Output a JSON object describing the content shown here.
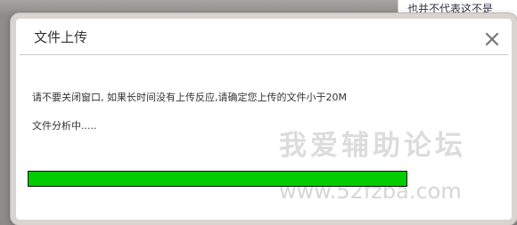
{
  "background": {
    "partial_text": "也并不代表这不是"
  },
  "dialog": {
    "title": "文件上传",
    "close_icon": "close-x-icon",
    "message": "请不要关闭窗口, 如果长时间没有上传反应,请确定您上传的文件小于20M",
    "status": "文件分析中.....",
    "progress_fraction": 1.0,
    "progress_color": "#00cc00"
  },
  "watermark": {
    "text": "我爱辅助论坛",
    "url": "www.52fzba.com"
  }
}
